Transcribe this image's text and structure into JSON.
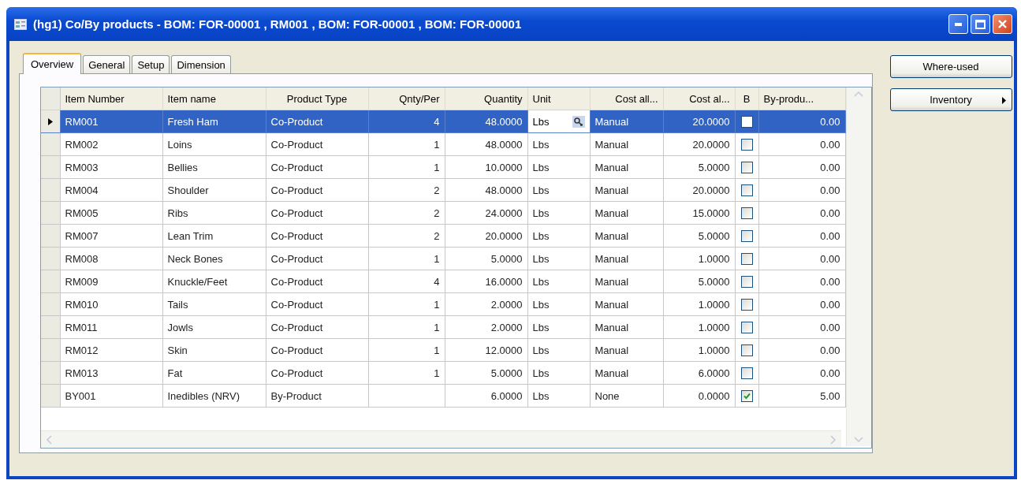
{
  "window": {
    "title": "(hg1) Co/By products - BOM: FOR-00001 , RM001 , BOM: FOR-00001 , BOM: FOR-00001"
  },
  "tabs": [
    {
      "label": "Overview",
      "selected": true
    },
    {
      "label": "General",
      "selected": false
    },
    {
      "label": "Setup",
      "selected": false
    },
    {
      "label": "Dimension",
      "selected": false
    }
  ],
  "table": {
    "columns": [
      {
        "label": "Item Number"
      },
      {
        "label": "Item name"
      },
      {
        "label": "Product Type"
      },
      {
        "label": "Qnty/Per"
      },
      {
        "label": "Quantity"
      },
      {
        "label": "Unit"
      },
      {
        "label": "Cost all..."
      },
      {
        "label": "Cost al..."
      },
      {
        "label": "B"
      },
      {
        "label": "By-produ..."
      }
    ],
    "rows": [
      {
        "selected": true,
        "item_number": "RM001",
        "item_name": "Fresh Ham",
        "product_type": "Co-Product",
        "qnty_per": "4",
        "quantity": "48.0000",
        "unit": "Lbs",
        "cost_allocation": "Manual",
        "cost_al": "20.0000",
        "b": false,
        "by_product": "0.00"
      },
      {
        "selected": false,
        "item_number": "RM002",
        "item_name": "Loins",
        "product_type": "Co-Product",
        "qnty_per": "1",
        "quantity": "48.0000",
        "unit": "Lbs",
        "cost_allocation": "Manual",
        "cost_al": "20.0000",
        "b": false,
        "by_product": "0.00"
      },
      {
        "selected": false,
        "item_number": "RM003",
        "item_name": "Bellies",
        "product_type": "Co-Product",
        "qnty_per": "1",
        "quantity": "10.0000",
        "unit": "Lbs",
        "cost_allocation": "Manual",
        "cost_al": "5.0000",
        "b": false,
        "by_product": "0.00"
      },
      {
        "selected": false,
        "item_number": "RM004",
        "item_name": "Shoulder",
        "product_type": "Co-Product",
        "qnty_per": "2",
        "quantity": "48.0000",
        "unit": "Lbs",
        "cost_allocation": "Manual",
        "cost_al": "20.0000",
        "b": false,
        "by_product": "0.00"
      },
      {
        "selected": false,
        "item_number": "RM005",
        "item_name": "Ribs",
        "product_type": "Co-Product",
        "qnty_per": "2",
        "quantity": "24.0000",
        "unit": "Lbs",
        "cost_allocation": "Manual",
        "cost_al": "15.0000",
        "b": false,
        "by_product": "0.00"
      },
      {
        "selected": false,
        "item_number": "RM007",
        "item_name": "Lean Trim",
        "product_type": "Co-Product",
        "qnty_per": "2",
        "quantity": "20.0000",
        "unit": "Lbs",
        "cost_allocation": "Manual",
        "cost_al": "5.0000",
        "b": false,
        "by_product": "0.00"
      },
      {
        "selected": false,
        "item_number": "RM008",
        "item_name": "Neck Bones",
        "product_type": "Co-Product",
        "qnty_per": "1",
        "quantity": "5.0000",
        "unit": "Lbs",
        "cost_allocation": "Manual",
        "cost_al": "1.0000",
        "b": false,
        "by_product": "0.00"
      },
      {
        "selected": false,
        "item_number": "RM009",
        "item_name": "Knuckle/Feet",
        "product_type": "Co-Product",
        "qnty_per": "4",
        "quantity": "16.0000",
        "unit": "Lbs",
        "cost_allocation": "Manual",
        "cost_al": "5.0000",
        "b": false,
        "by_product": "0.00"
      },
      {
        "selected": false,
        "item_number": "RM010",
        "item_name": "Tails",
        "product_type": "Co-Product",
        "qnty_per": "1",
        "quantity": "2.0000",
        "unit": "Lbs",
        "cost_allocation": "Manual",
        "cost_al": "1.0000",
        "b": false,
        "by_product": "0.00"
      },
      {
        "selected": false,
        "item_number": "RM011",
        "item_name": "Jowls",
        "product_type": "Co-Product",
        "qnty_per": "1",
        "quantity": "2.0000",
        "unit": "Lbs",
        "cost_allocation": "Manual",
        "cost_al": "1.0000",
        "b": false,
        "by_product": "0.00"
      },
      {
        "selected": false,
        "item_number": "RM012",
        "item_name": "Skin",
        "product_type": "Co-Product",
        "qnty_per": "1",
        "quantity": "12.0000",
        "unit": "Lbs",
        "cost_allocation": "Manual",
        "cost_al": "1.0000",
        "b": false,
        "by_product": "0.00"
      },
      {
        "selected": false,
        "item_number": "RM013",
        "item_name": "Fat",
        "product_type": "Co-Product",
        "qnty_per": "1",
        "quantity": "5.0000",
        "unit": "Lbs",
        "cost_allocation": "Manual",
        "cost_al": "6.0000",
        "b": false,
        "by_product": "0.00"
      },
      {
        "selected": false,
        "item_number": "BY001",
        "item_name": "Inedibles (NRV)",
        "product_type": "By-Product",
        "quantity": "6.0000",
        "unit": "Lbs",
        "cost_allocation": "None",
        "cost_al": "0.0000",
        "b": true,
        "by_product": "5.00"
      }
    ]
  },
  "buttons": [
    {
      "label": "Where-used",
      "kind": "plain"
    },
    {
      "label": "Inventory",
      "kind": "menu"
    }
  ]
}
